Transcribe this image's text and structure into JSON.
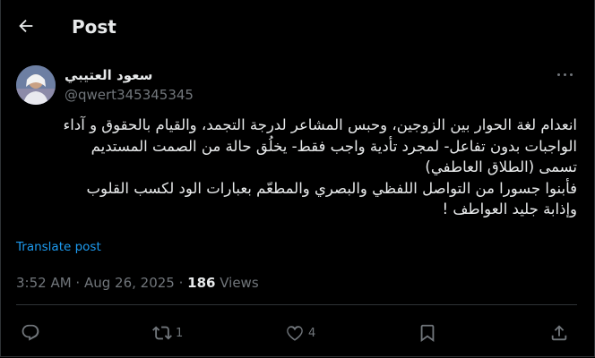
{
  "header": {
    "title": "Post"
  },
  "author": {
    "name": "سعود العتيبي",
    "handle": "@qwert345345345"
  },
  "post": {
    "lines": [
      "انعدام لغة الحوار بين الزوجين، وحبس المشاعر  لدرجة التجمد، والقيام بالحقوق و آداء",
      "الواجبات بدون تفاعل- لمجرد تأدية واجب فقط- يخلُق حالة من الصمت المستديم",
      "تسمى (الطلاق العاطفي)",
      "فأبنوا جسورا من التواصل اللفظي والبصري  والمطعّم بعبارات الود لكسب القلوب",
      "وإذابة جليد العواطف !"
    ],
    "translate_label": "Translate post"
  },
  "meta": {
    "time": "3:52 AM",
    "sep1": " · ",
    "date": "Aug 26, 2025",
    "sep2": " · ",
    "views_count": "186",
    "views_label": " Views"
  },
  "actions": {
    "reply_count": "",
    "repost_count": "1",
    "like_count": "4"
  },
  "icons": [
    "back-arrow-icon",
    "more-icon",
    "reply-icon",
    "repost-icon",
    "like-icon",
    "bookmark-icon",
    "share-icon"
  ],
  "colors": {
    "background": "#000000",
    "text": "#e7e9ea",
    "muted": "#71767b",
    "accent": "#1d9bf0",
    "border": "#2f3336"
  }
}
